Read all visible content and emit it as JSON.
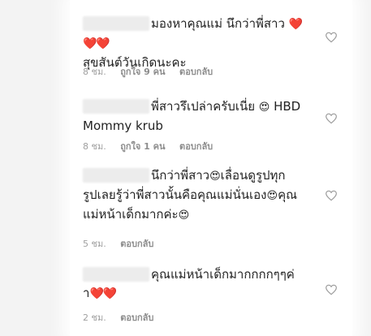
{
  "comments": [
    {
      "text_a": "มองหาคุณแม่ นึกว่าพี่สาว ",
      "hearts_a": "❤️❤️❤️",
      "text_b": "สุขสันต์วันเกิดนะคะ",
      "time": "8 ชม.",
      "likes": "ถูกใจ 9 คน",
      "reply": "ตอบกลับ"
    },
    {
      "text_a": "พี่สาวรึเปล่าครับเนี่ย ",
      "emoji_a": "😍",
      "text_b": " HBD",
      "text_c": "Mommy krub",
      "time": "8 ชม.",
      "likes": "ถูกใจ 1 คน",
      "reply": "ตอบกลับ"
    },
    {
      "text_a": "นึกว่าพี่สาว",
      "emoji_a": "😍",
      "text_b": "เลื่อนดูรูปทุก",
      "text_c": "รูปเลยรู้ว่าพี่สาวนั้นคือคุณแม่นั่นเอง",
      "emoji_b": "😍",
      "text_d": "คุณ",
      "text_e": "แม่หน้าเด็กมากค่ะ",
      "emoji_c": "😍",
      "time": "5 ชม.",
      "reply": "ตอบกลับ"
    },
    {
      "text_a": "คุณแม่หน้าเด็กมากกกกๆๆค่",
      "text_b": "า",
      "hearts_a": "❤️❤️",
      "time": "2 ชม.",
      "reply": "ตอบกลับ"
    }
  ],
  "icons": {
    "like": "heart-outline-icon"
  },
  "colors": {
    "meta": "#a0a0a0",
    "heart_outline": "#9a9a9a"
  }
}
